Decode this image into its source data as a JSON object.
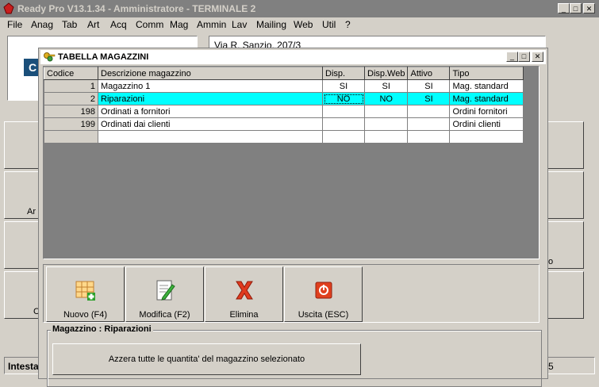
{
  "app": {
    "title": "Ready Pro V13.1.34 - Amministratore - TERMINALE 2",
    "win_minimize": "_",
    "win_restore": "□",
    "win_close": "✕"
  },
  "menu": [
    "File",
    "Anag",
    "Tab",
    "Art",
    "Acq",
    "Comm",
    "Mag",
    "Ammin",
    "Lav",
    "Mailing",
    "Web",
    "Util",
    "?"
  ],
  "background": {
    "address": "Via R. Sanzio, 207/3",
    "left_label_1": "Ar",
    "left_label_2": "C",
    "right_label": "o",
    "status_left": "Intesta",
    "status_right": "5",
    "logo_letter": "C"
  },
  "dialog": {
    "title": "TABELLA MAGAZZINI",
    "columns": [
      "Codice",
      "Descrizione magazzino",
      "Disp.",
      "Disp.Web",
      "Attivo",
      "Tipo"
    ],
    "rows": [
      {
        "codice": "1",
        "descrizione": "Magazzino 1",
        "disp": "SI",
        "disp_web": "SI",
        "attivo": "SI",
        "tipo": "Mag. standard"
      },
      {
        "codice": "2",
        "descrizione": "Riparazioni",
        "disp": "NO",
        "disp_web": "NO",
        "attivo": "SI",
        "tipo": "Mag. standard"
      },
      {
        "codice": "198",
        "descrizione": "Ordinati a fornitori",
        "disp": "",
        "disp_web": "",
        "attivo": "",
        "tipo": "Ordini fornitori"
      },
      {
        "codice": "199",
        "descrizione": "Ordinati dai clienti",
        "disp": "",
        "disp_web": "",
        "attivo": "",
        "tipo": "Ordini clienti"
      }
    ],
    "buttons": {
      "nuovo": "Nuovo (F4)",
      "modifica": "Modifica (F2)",
      "elimina": "Elimina",
      "uscita": "Uscita (ESC)"
    },
    "group_title": "Magazzino : Riparazioni",
    "azzera": "Azzera tutte le quantita' del magazzino selezionato"
  }
}
